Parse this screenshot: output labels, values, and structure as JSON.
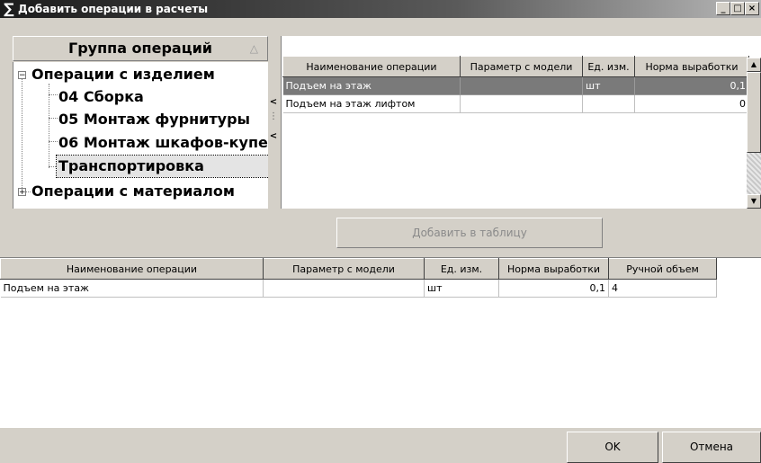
{
  "window": {
    "title": "Добавить операции в расчеты",
    "icon": "sigma-icon",
    "controls": {
      "minimize": "_",
      "maximize": "□",
      "close": "×"
    }
  },
  "group_panel": {
    "header": "Группа операций",
    "sort_indicator": "△",
    "tree": [
      {
        "label": "Операции с изделием",
        "expander": "−",
        "children": [
          {
            "label": "04 Сборка"
          },
          {
            "label": "05 Монтаж фурнитуры"
          },
          {
            "label": "06 Монтаж шкафов-купе"
          },
          {
            "label": "Транспортировка",
            "selected": true
          }
        ]
      },
      {
        "label": "Операции с материалом",
        "expander": "+"
      }
    ]
  },
  "splitter": {
    "arrow_right": "<",
    "arrow_left": "<"
  },
  "operations_grid": {
    "columns": [
      "Наименование операции",
      "Параметр с модели",
      "Ед. изм.",
      "Норма выработки"
    ],
    "rows": [
      {
        "name": "Подъем на этаж",
        "param": "",
        "unit": "шт",
        "norm": "0,1",
        "selected": true
      },
      {
        "name": "Подъем на этаж лифтом",
        "param": "",
        "unit": "",
        "norm": "0"
      }
    ]
  },
  "add_button": "Добавить в таблицу",
  "result_grid": {
    "columns": [
      "Наименование операции",
      "Параметр с модели",
      "Ед. изм.",
      "Норма выработки",
      "Ручной объем"
    ],
    "rows": [
      {
        "name": "Подъем на этаж",
        "param": "",
        "unit": "шт",
        "norm": "0,1",
        "manual": "4"
      }
    ]
  },
  "footer": {
    "ok": "OK",
    "cancel": "Отмена"
  }
}
